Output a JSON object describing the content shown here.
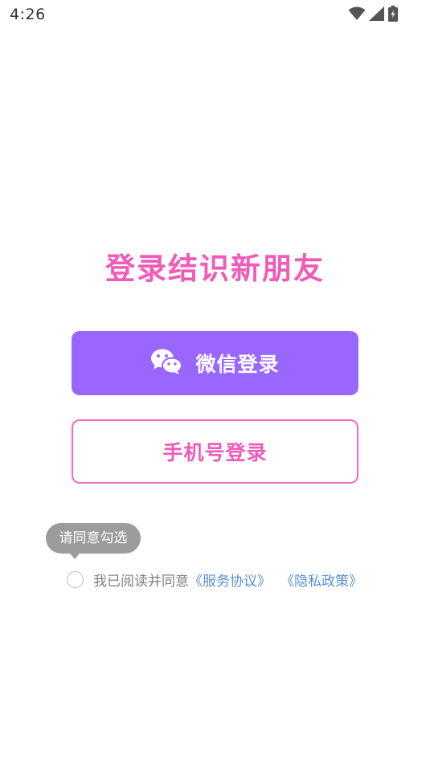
{
  "status_bar": {
    "time": "4:26",
    "icons": [
      "wifi-icon",
      "cellular-signal-icon",
      "battery-charging-icon"
    ]
  },
  "slogan": "登录结识新朋友",
  "wechat_login": {
    "label": "微信登录",
    "icon": "wechat-icon",
    "background_color": "#9966ff"
  },
  "phone_login": {
    "label": "手机号登录",
    "border_color": "#f06bc6"
  },
  "tooltip": "请同意勾选",
  "agreement": {
    "checked": false,
    "prefix": "我已阅读并同意",
    "service_link": "《服务协议》",
    "privacy_link": "《隐私政策》"
  },
  "colors": {
    "accent_pink": "#f05bb8",
    "accent_purple": "#9966ff",
    "link_blue": "#5b8fd8"
  }
}
